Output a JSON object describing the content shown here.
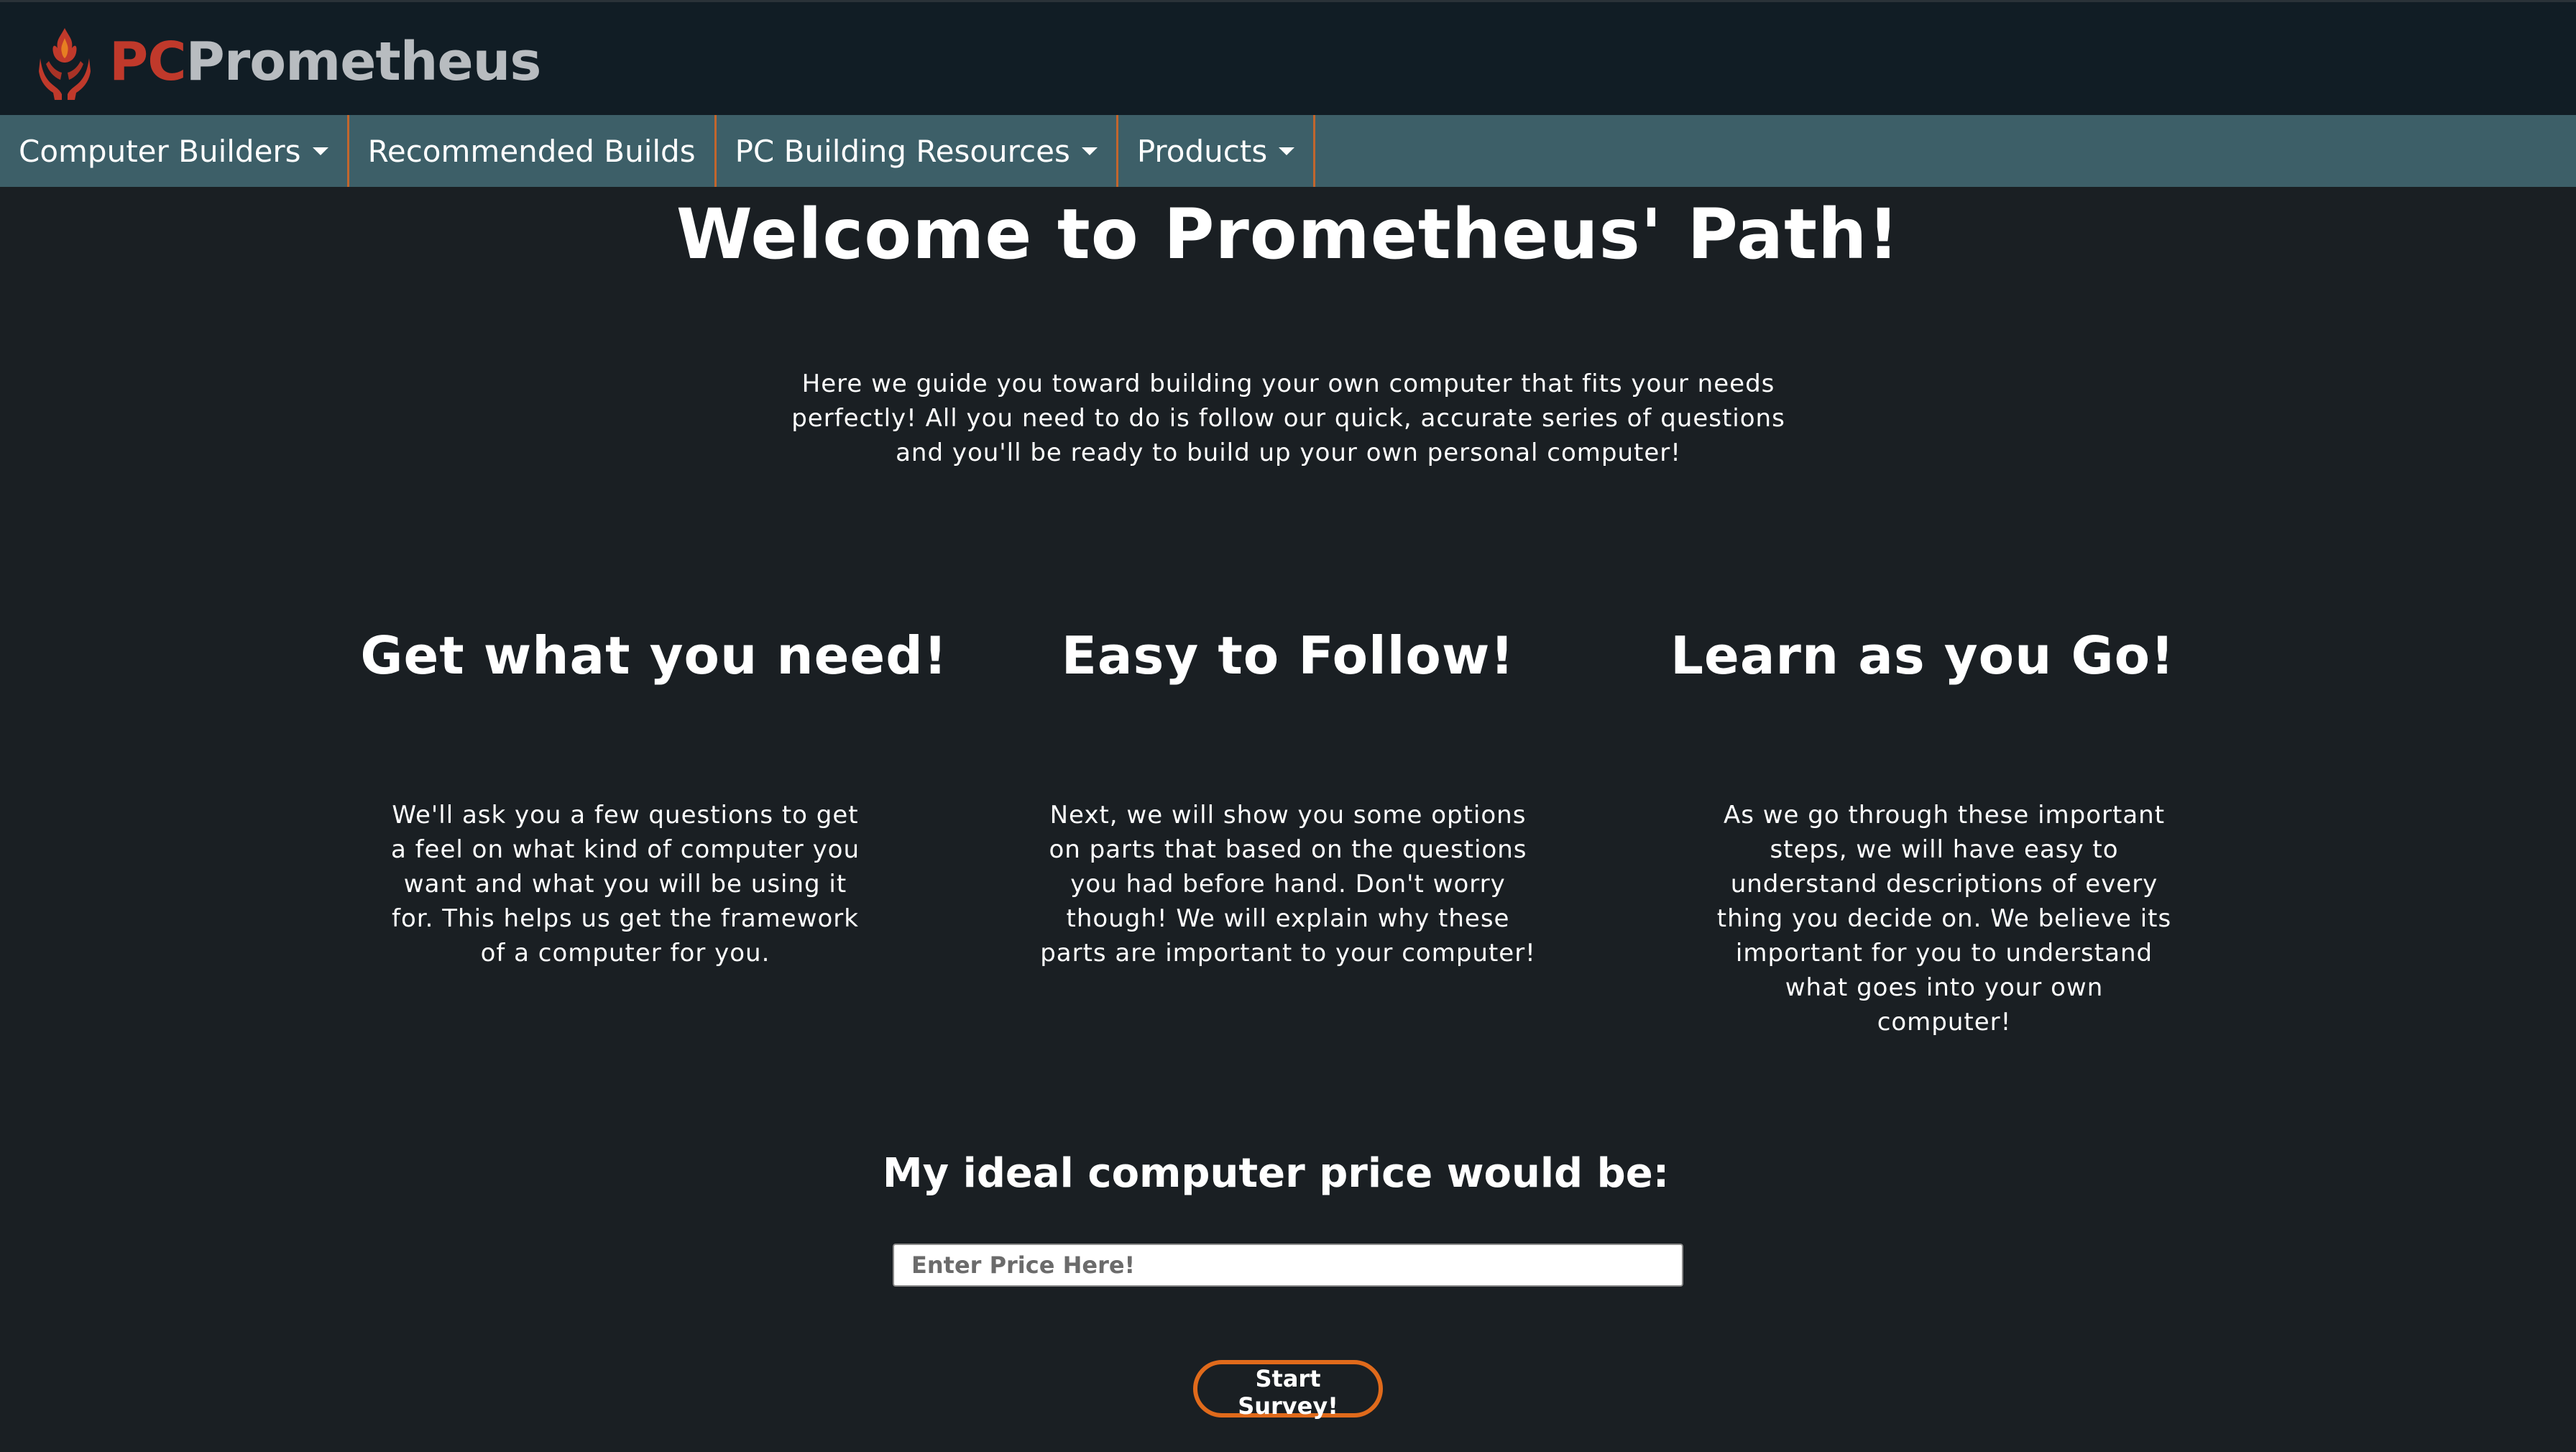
{
  "header": {
    "logo": {
      "icon": "flame-hands-icon",
      "brand_prefix": "PC",
      "brand_name": "Prometheus"
    }
  },
  "nav": {
    "items": [
      {
        "label": "Computer Builders",
        "has_dropdown": true
      },
      {
        "label": "Recommended Builds",
        "has_dropdown": false
      },
      {
        "label": "PC Building Resources",
        "has_dropdown": true
      },
      {
        "label": "Products",
        "has_dropdown": true
      }
    ]
  },
  "main": {
    "title": "Welcome to Prometheus' Path!",
    "intro": "Here we guide you toward building your own computer that fits your needs perfectly! All you need to do is follow our quick, accurate series of questions and you'll be ready to build up your own personal computer!",
    "features": [
      {
        "heading": "Get what you need!",
        "text": "We'll ask you a few questions to get a feel on what kind of computer you want and what you will be using it for. This helps us get the framework of a computer for you."
      },
      {
        "heading": "Easy to Follow!",
        "text": "Next, we will show you some options on parts that based on the questions you had before hand. Don't worry though! We will explain why these parts are important to your computer!"
      },
      {
        "heading": "Learn as you Go!",
        "text": "As we go through these important steps, we will have easy to understand descriptions of every thing you decide on. We believe its important for you to understand what goes into your own computer!"
      }
    ],
    "price": {
      "label": "My ideal computer price would be:",
      "placeholder": "Enter Price Here!",
      "value": ""
    },
    "survey_button": "Start Survey!"
  },
  "colors": {
    "header_bg": "#111d25",
    "nav_bg": "#3d5f68",
    "accent": "#e06a1b",
    "brand_red": "#c0392b",
    "page_bg": "#1a1f23"
  }
}
